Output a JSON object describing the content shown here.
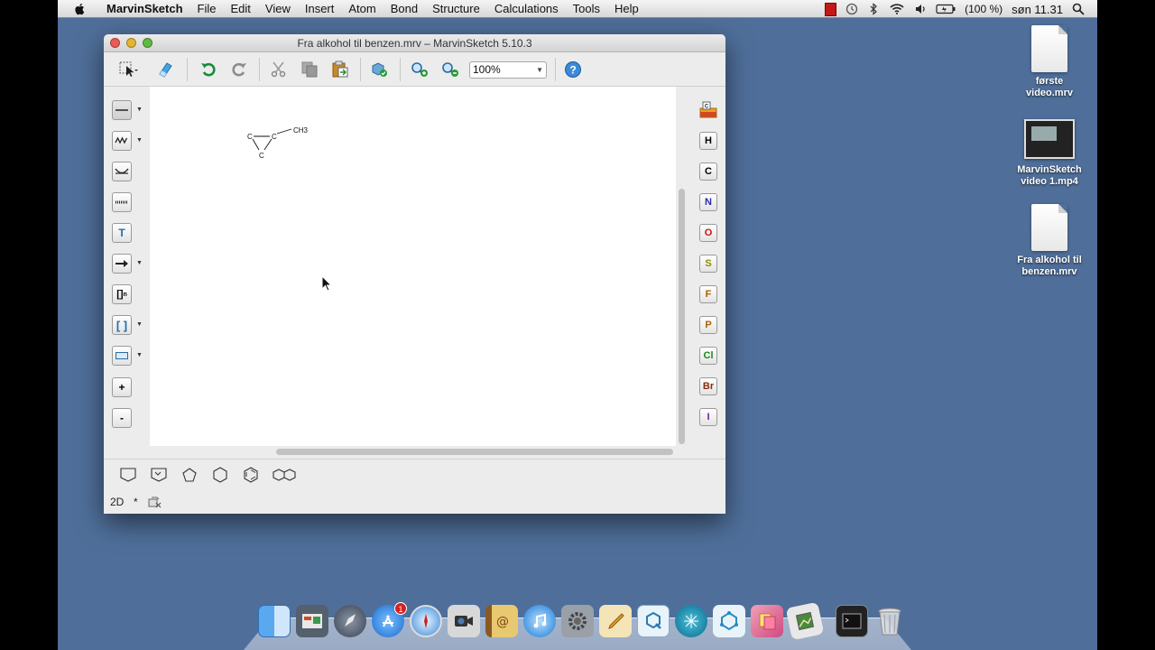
{
  "menubar": {
    "app_name": "MarvinSketch",
    "items": [
      "File",
      "Edit",
      "View",
      "Insert",
      "Atom",
      "Bond",
      "Structure",
      "Calculations",
      "Tools",
      "Help"
    ],
    "battery": "(100 %)",
    "clock": "søn 11.31"
  },
  "window": {
    "title": "Fra alkohol til benzen.mrv – MarvinSketch 5.10.3",
    "zoom": "100%",
    "left_tools": {
      "text_tool": "T",
      "bracket_tool": "[]",
      "bracket_sub": "n",
      "bracket_tool_2": "[ ]",
      "zoom_in": "+",
      "zoom_out": "-"
    },
    "elements": [
      "H",
      "C",
      "N",
      "O",
      "S",
      "F",
      "P",
      "Cl",
      "Br",
      "I"
    ],
    "element_colors": [
      "#222222",
      "#222222",
      "#2a2aa8",
      "#d01010",
      "#8a8a00",
      "#b06000",
      "#b06000",
      "#1a8a1a",
      "#8a2a10",
      "#7a20a0"
    ],
    "status": {
      "mode": "2D",
      "modified": "*"
    },
    "molecule": {
      "atoms": [
        "C",
        "C",
        "C",
        "CH3"
      ]
    }
  },
  "desktop": {
    "icons": [
      {
        "label_line1": "første",
        "label_line2": "video.mrv"
      },
      {
        "label_line1": "MarvinSketch",
        "label_line2": "video 1.mp4"
      },
      {
        "label_line1": "Fra alkohol til",
        "label_line2": "benzen.mrv"
      }
    ]
  },
  "dock": {
    "badge": "1"
  }
}
